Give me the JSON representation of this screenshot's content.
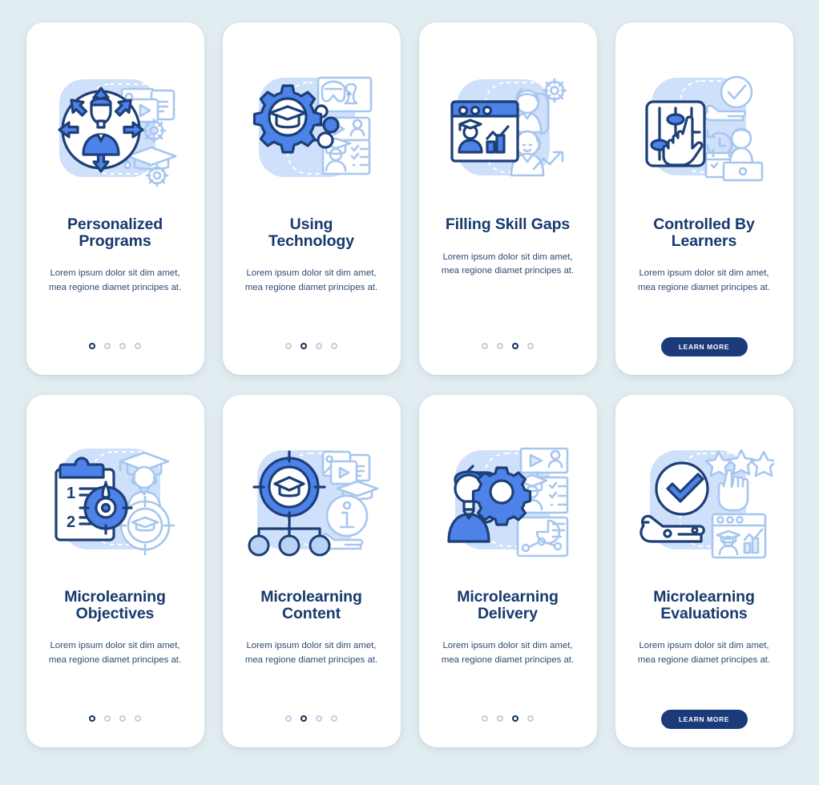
{
  "page": {
    "background_color": "#e2edf1",
    "card_background": "#ffffff",
    "title_color": "#173a6e",
    "body_color": "#2e4a72",
    "accent_color": "#4d82e8",
    "button_color": "#1b3a7a"
  },
  "body_text": "Lorem ipsum dolor sit dim amet, mea regione diamet principes at.",
  "cta_label": "LEARN MORE",
  "screens": [
    {
      "id": "personalized-programs",
      "title_line1": "Personalized",
      "title_line2": "Programs",
      "body": "Lorem ipsum dolor sit dim amet, mea regione diamet principes at.",
      "footer_type": "dots",
      "dots_total": 4,
      "dot_active_index": 0,
      "illustration": "person-in-circle-with-arrows-media-graduation-cap-gear"
    },
    {
      "id": "using-technology",
      "title_line1": "Using",
      "title_line2": "Technology",
      "body": "Lorem ipsum dolor sit dim amet, mea regione diamet principes at.",
      "footer_type": "dots",
      "dots_total": 4,
      "dot_active_index": 1,
      "illustration": "gear-with-graduation-cap-nodes-vr-headset-video-checklist"
    },
    {
      "id": "filling-skill-gaps",
      "title_line1": "Filling Skill Gaps",
      "title_line2": "",
      "body": "Lorem ipsum dolor sit dim amet, mea regione diamet principes at.",
      "footer_type": "dots",
      "dots_total": 4,
      "dot_active_index": 2,
      "illustration": "browser-window-graduate-bar-chart-people-gear-growth-arrow"
    },
    {
      "id": "controlled-by-learners",
      "title_line1": "Controlled By",
      "title_line2": "Learners",
      "body": "Lorem ipsum dolor sit dim amet, mea regione diamet principes at.",
      "footer_type": "button",
      "button_label": "LEARN MORE",
      "illustration": "sliders-panel-pointing-hand-checkmark-clock-calendar-person"
    },
    {
      "id": "microlearning-objectives",
      "title_line1": "Microlearning",
      "title_line2": "Objectives",
      "body": "Lorem ipsum dolor sit dim amet, mea regione diamet principes at.",
      "footer_type": "dots",
      "dots_total": 4,
      "dot_active_index": 0,
      "illustration": "clipboard-numbered-list-dart-target-graduate-cap-target",
      "clipboard_items": [
        "1",
        "2"
      ]
    },
    {
      "id": "microlearning-content",
      "title_line1": "Microlearning",
      "title_line2": "Content",
      "body": "Lorem ipsum dolor sit dim amet, mea regione diamet principes at.",
      "footer_type": "dots",
      "dots_total": 4,
      "dot_active_index": 1,
      "illustration": "target-graduation-cap-hierarchy-tree-media-info-icon-hand"
    },
    {
      "id": "microlearning-delivery",
      "title_line1": "Microlearning",
      "title_line2": "Delivery",
      "body": "Lorem ipsum dolor sit dim amet, mea regione diamet principes at.",
      "footer_type": "dots",
      "dots_total": 4,
      "dot_active_index": 2,
      "illustration": "person-arrow-gear-video-player-graduate-checklist-pie-chart"
    },
    {
      "id": "microlearning-evaluations",
      "title_line1": "Microlearning",
      "title_line2": "Evaluations",
      "body": "Lorem ipsum dolor sit dim amet, mea regione diamet principes at.",
      "footer_type": "button",
      "button_label": "LEARN MORE",
      "illustration": "hand-holding-checkmark-stars-rating-pointing-hand-browser-chart"
    }
  ]
}
